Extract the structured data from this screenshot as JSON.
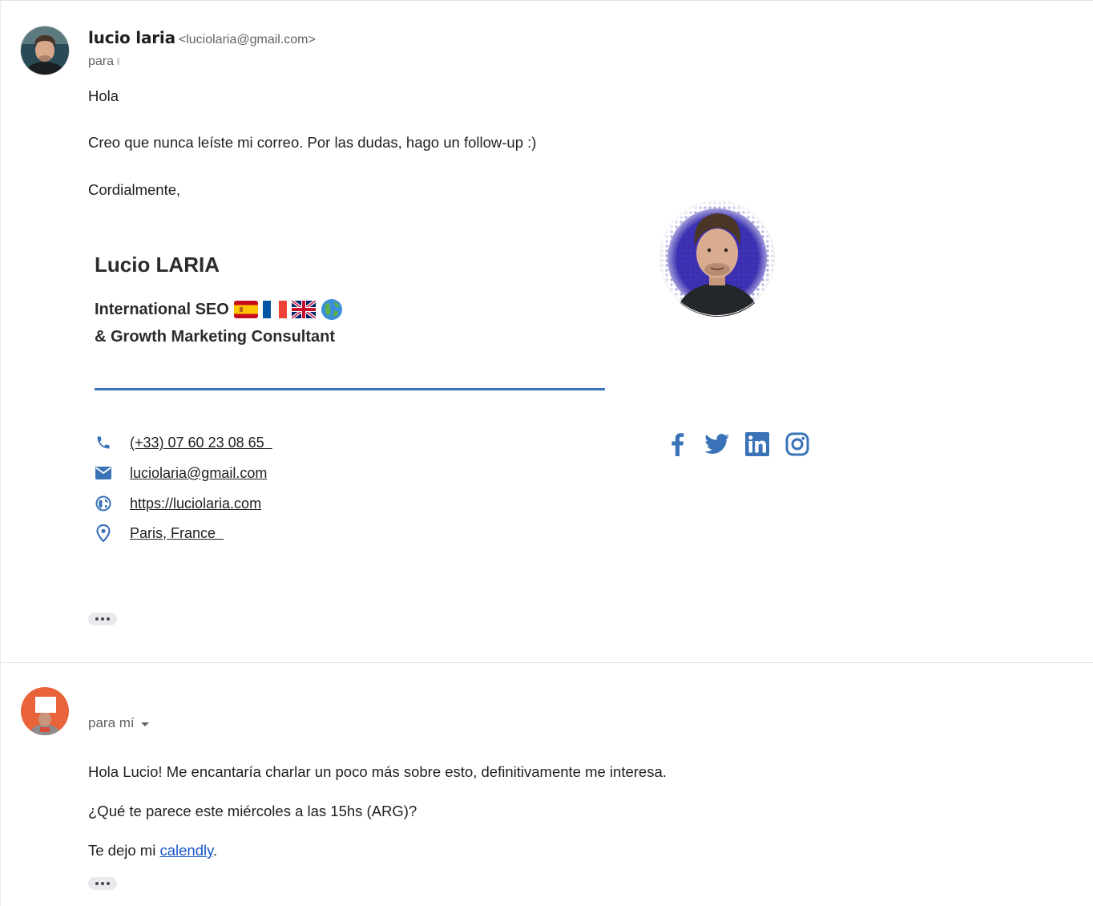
{
  "message1": {
    "sender_name": "lucio laria",
    "sender_email": "<luciolaria@gmail.com>",
    "to_label": "para",
    "body": {
      "greeting": "Hola",
      "line1": "Creo que nunca leíste mi correo. Por las dudas, hago un follow-up :)",
      "closing": "Cordialmente,"
    },
    "signature": {
      "name": "Lucio LARIA",
      "title_line1": "International SEO",
      "flags": [
        "spain-flag-icon",
        "france-flag-icon",
        "uk-flag-icon",
        "globe-icon"
      ],
      "title_line2": "& Growth Marketing Consultant",
      "accent_color": "#3a73b7",
      "contacts": [
        {
          "icon": "phone-icon",
          "text": "(+33) 07 60 23 08 65  "
        },
        {
          "icon": "mail-icon",
          "text": "luciolaria@gmail.com"
        },
        {
          "icon": "globe-icon",
          "text": "https://luciolaria.com"
        },
        {
          "icon": "location-pin-icon",
          "text": "Paris, France  "
        }
      ],
      "social": [
        "facebook-icon",
        "twitter-icon",
        "linkedin-icon",
        "instagram-icon"
      ]
    }
  },
  "message2": {
    "to_label": "para mí",
    "body": {
      "line1": "Hola Lucio! Me encantaría charlar un poco más sobre esto, definitivamente me interesa.",
      "line2": "¿Qué te parece este miércoles a las 15hs (ARG)?",
      "line3_prefix": "Te dejo mi ",
      "line3_link": "calendly",
      "line3_suffix": "."
    }
  }
}
